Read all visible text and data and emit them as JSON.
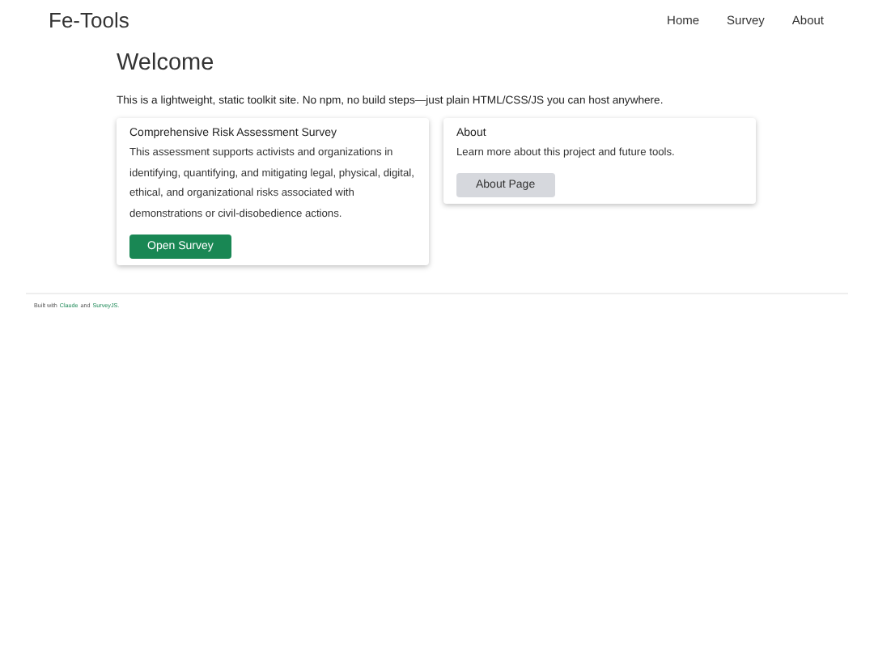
{
  "brand": "Fe-Tools",
  "nav": [
    {
      "label": "Home"
    },
    {
      "label": "Survey"
    },
    {
      "label": "About"
    }
  ],
  "heading": "Welcome",
  "intro": "This is a lightweight, static toolkit site. No npm, no build steps—just plain HTML/CSS/JS you can host anywhere.",
  "cards": [
    {
      "title": "Comprehensive Risk Assessment Survey",
      "text": "This assessment supports activists and organizations in identifying, quantifying, and mitigating legal, physical, digital, ethical, and organizational risks associated with demonstrations or civil-disobedience actions.",
      "button": {
        "label": "Open Survey",
        "kind": "primary"
      }
    },
    {
      "title": "About",
      "text": "Learn more about this project and future tools.",
      "button": {
        "label": "About Page",
        "kind": "secondary"
      }
    }
  ],
  "footer": {
    "prefix": "Built with",
    "links": [
      "Claude",
      "SurveyJS."
    ],
    "joiner": "and"
  }
}
